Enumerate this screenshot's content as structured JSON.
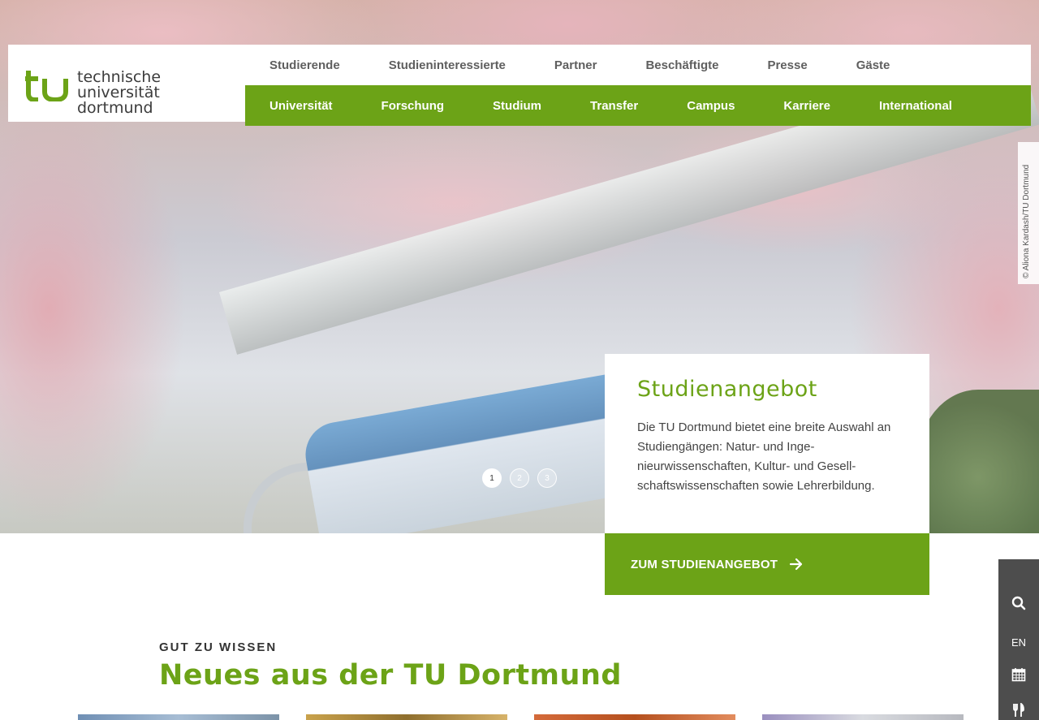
{
  "logo": {
    "line1": "technische universität",
    "line2": "dortmund"
  },
  "nav_top": [
    "Studierende",
    "Studieninteressierte",
    "Partner",
    "Beschäftigte",
    "Presse",
    "Gäste"
  ],
  "nav_main": [
    "Universität",
    "Forschung",
    "Studium",
    "Transfer",
    "Campus",
    "Karriere",
    "International"
  ],
  "hero": {
    "credit": "© Aliona Kardash/TU Dortmund",
    "slides": [
      "1",
      "2",
      "3"
    ],
    "active_slide": 1
  },
  "teaser": {
    "title": "Studienangebot",
    "text": "Die TU Dortmund bietet eine breite Aus­wahl an Studiengängen: Natur- und Inge­nieurwissenschaften, Kultur- und Gesell­schaftswissenschaften sowie Lehrerbil­dung.",
    "cta": "ZUM STUDIENANGEBOT"
  },
  "sidebar": {
    "lang": "EN",
    "icons": [
      "search-icon",
      "calendar-icon",
      "cutlery-icon"
    ]
  },
  "news": {
    "kicker": "GUT ZU WISSEN",
    "title": "Neues aus der TU Dortmund"
  },
  "colors": {
    "brand_green": "#6ca317",
    "toolbar_gray": "#4d4d4d"
  }
}
